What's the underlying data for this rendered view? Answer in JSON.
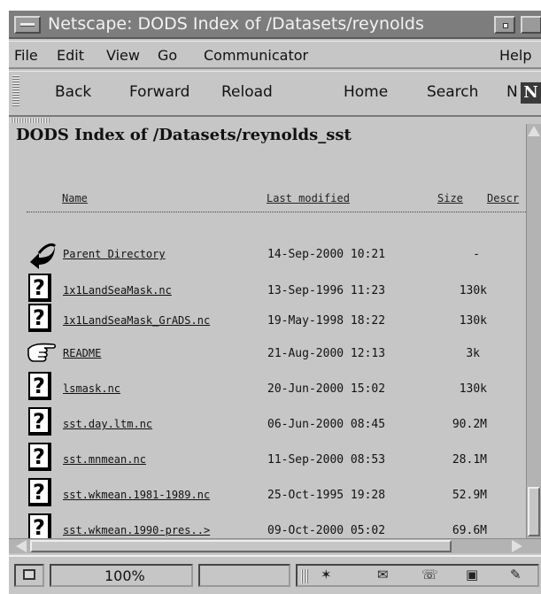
{
  "window": {
    "title": "Netscape: DODS Index of /Datasets/reynolds"
  },
  "menubar": {
    "items": [
      "File",
      "Edit",
      "View",
      "Go",
      "Communicator",
      "Help"
    ]
  },
  "toolbar": {
    "back": "Back",
    "forward": "Forward",
    "reload": "Reload",
    "home": "Home",
    "search": "Search",
    "netscape_partial": "N",
    "logo_letter": "N"
  },
  "page": {
    "title": "DODS Index of /Datasets/reynolds_sst",
    "columns": {
      "name": "Name",
      "last_modified": "Last modified",
      "size": "Size",
      "description": "Descr"
    },
    "files": [
      {
        "name": "Parent Directory",
        "modified": "14-Sep-2000 10:21",
        "size": "-",
        "icon": "back-arrow-icon"
      },
      {
        "name": "1x1LandSeaMask.nc",
        "modified": "13-Sep-1996 11:23",
        "size": "130k",
        "icon": "unknown-file-icon"
      },
      {
        "name": "1x1LandSeaMask_GrADS.nc",
        "modified": "19-May-1998 18:22",
        "size": "130k",
        "icon": "unknown-file-icon"
      },
      {
        "name": "README",
        "modified": "21-Aug-2000 12:13",
        "size": "3k",
        "icon": "hand-pointer-icon"
      },
      {
        "name": "lsmask.nc",
        "modified": "20-Jun-2000 15:02",
        "size": "130k",
        "icon": "unknown-file-icon"
      },
      {
        "name": "sst.day.ltm.nc",
        "modified": "06-Jun-2000 08:45",
        "size": "90.2M",
        "icon": "unknown-file-icon"
      },
      {
        "name": "sst.mnmean.nc",
        "modified": "11-Sep-2000 08:53",
        "size": "28.1M",
        "icon": "unknown-file-icon"
      },
      {
        "name": "sst.wkmean.1981-1989.nc",
        "modified": "25-Oct-1995 19:28",
        "size": "52.9M",
        "icon": "unknown-file-icon"
      },
      {
        "name": "sst.wkmean.1990-pres..>",
        "modified": "09-Oct-2000 05:02",
        "size": "69.6M",
        "icon": "unknown-file-icon"
      }
    ]
  },
  "statusbar": {
    "zoom": "100%"
  },
  "colors": {
    "chrome": "#c6c6c6",
    "titlebar": "#7d7d7d"
  }
}
